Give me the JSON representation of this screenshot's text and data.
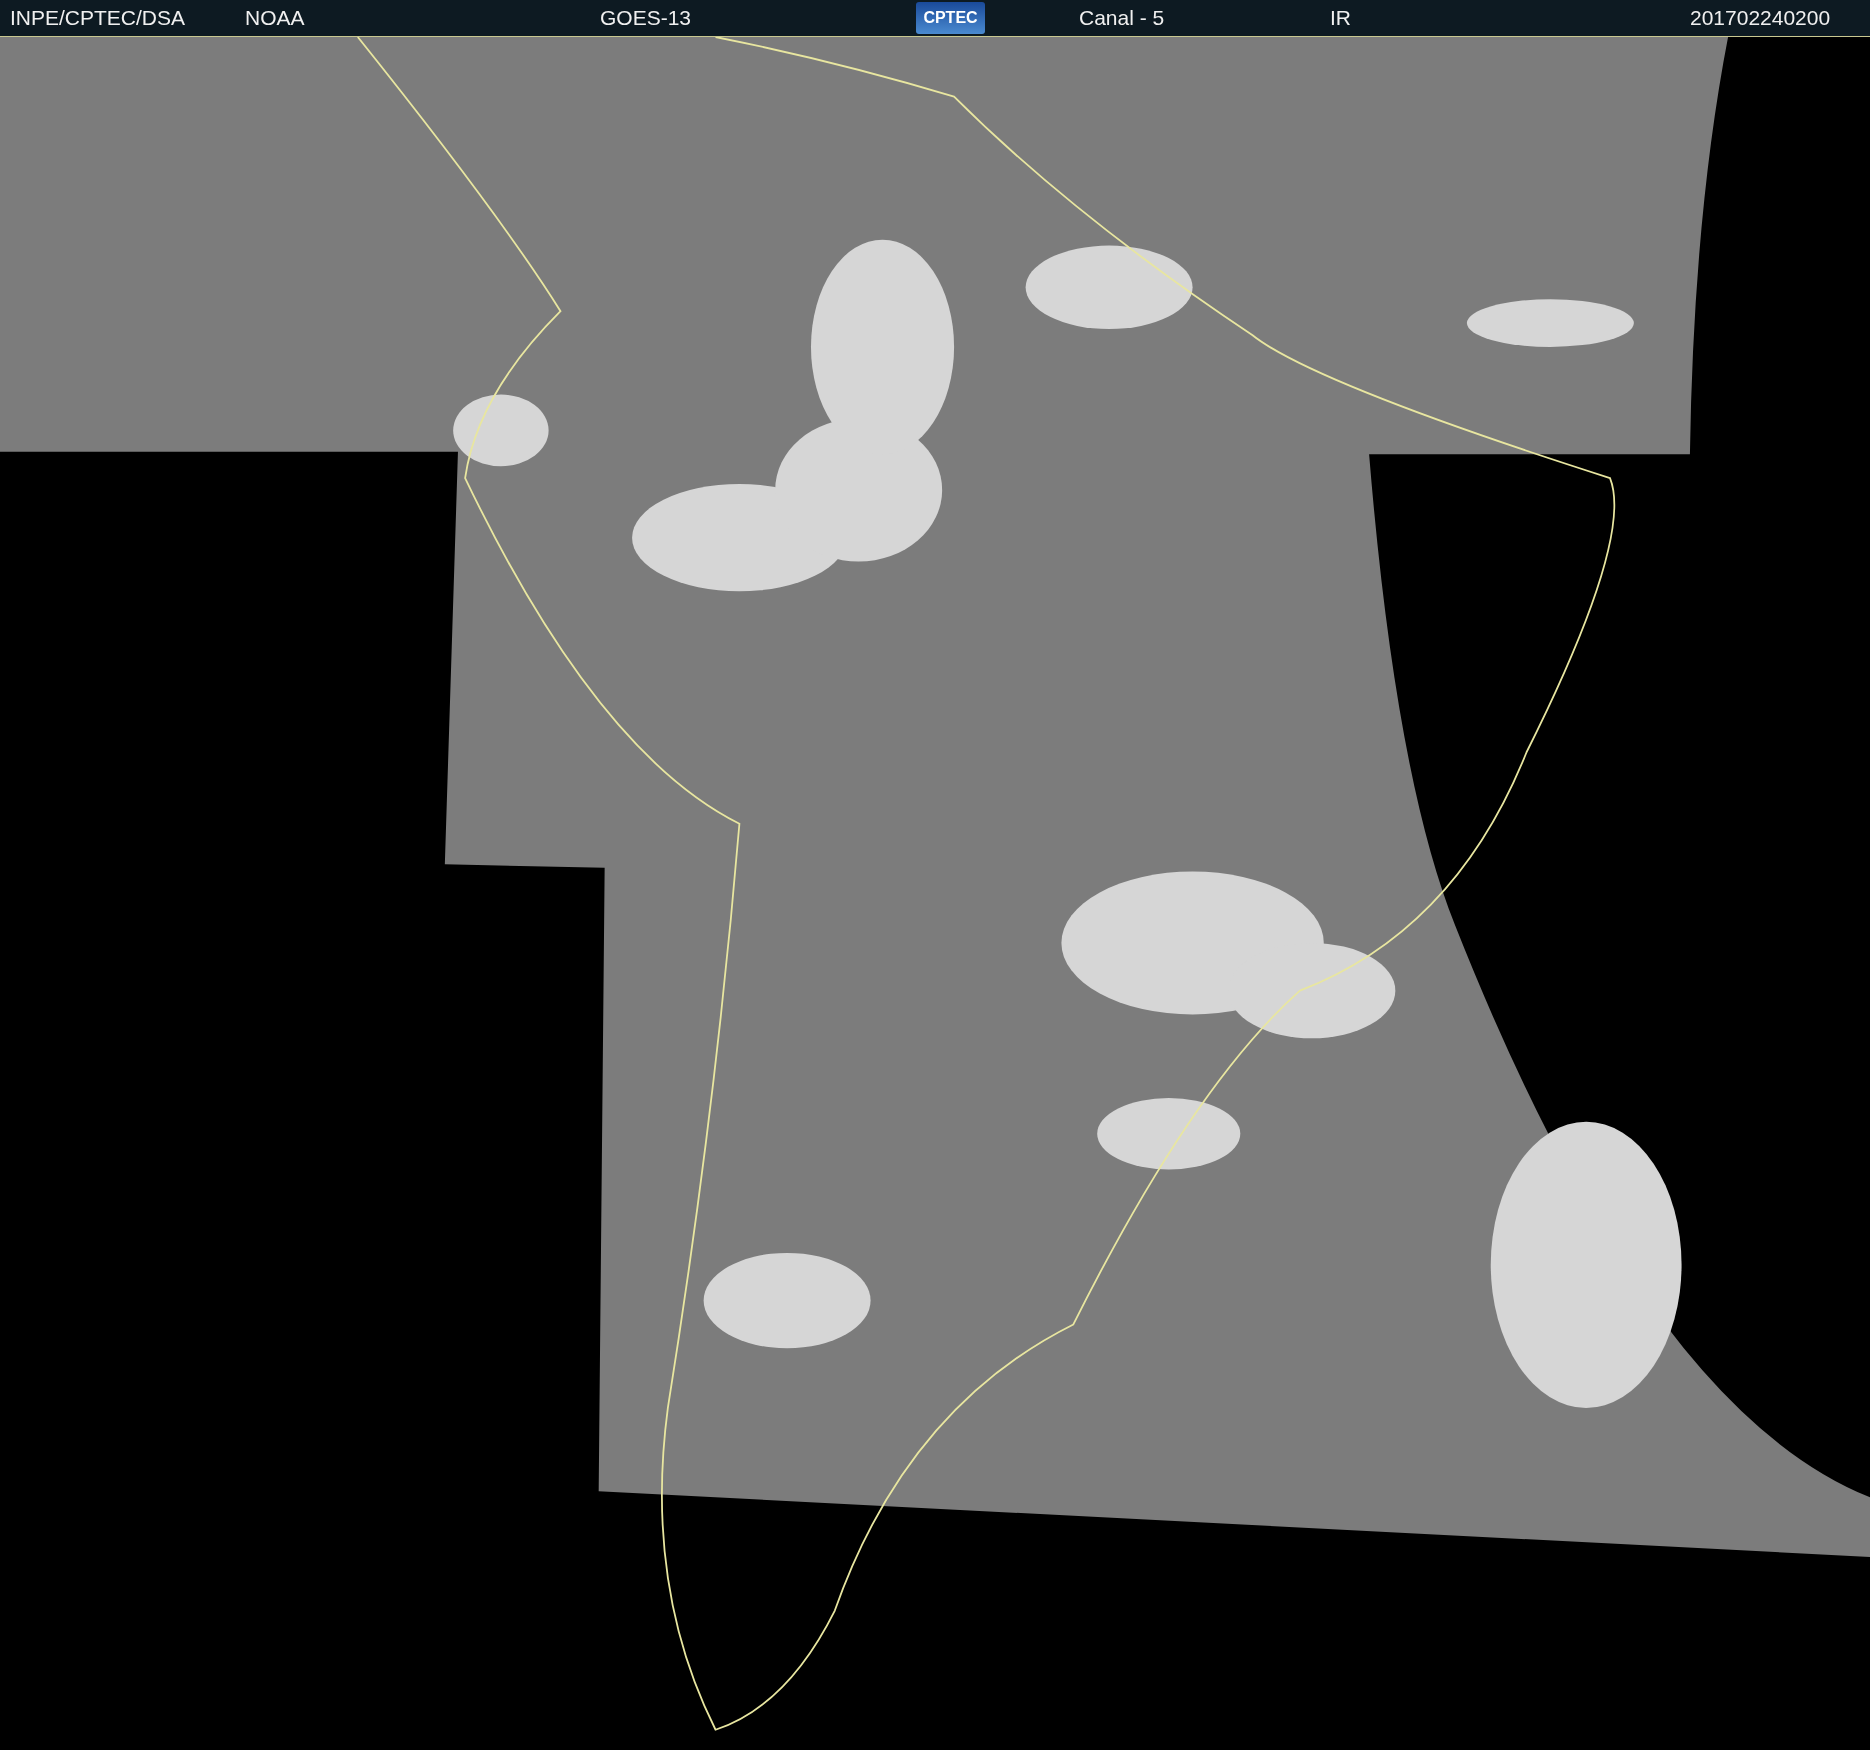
{
  "header": {
    "items": [
      {
        "kind": "text",
        "text": "INPE/CPTEC/DSA"
      },
      {
        "kind": "text",
        "text": "NOAA"
      },
      {
        "kind": "text",
        "text": "GOES-13"
      },
      {
        "kind": "logo",
        "text": "CPTEC"
      },
      {
        "kind": "text",
        "text": "Canal - 5"
      },
      {
        "kind": "text",
        "text": "IR"
      },
      {
        "kind": "text",
        "text": "201702240200"
      }
    ]
  }
}
